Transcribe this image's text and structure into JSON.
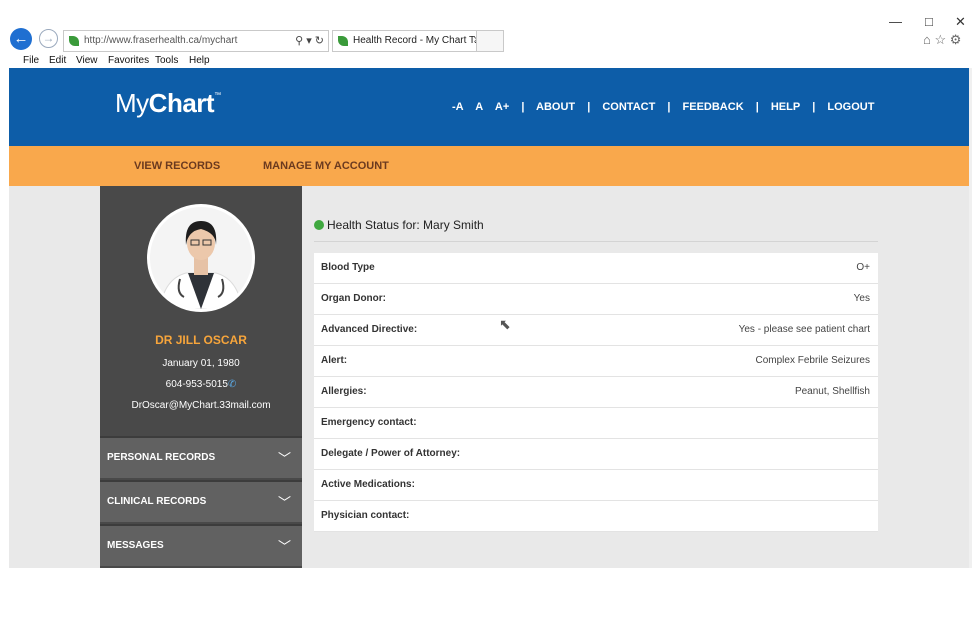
{
  "browser": {
    "url": "http://www.fraserhealth.ca/mychart",
    "tab_title": "Health Record - My Chart T...",
    "menu": [
      "File",
      "Edit",
      "View",
      "Favorites",
      "Tools",
      "Help"
    ],
    "window_controls": {
      "minimize": "—",
      "maximize": "□",
      "close": "✕"
    },
    "right_icons": "⌂ ☆ ⚙"
  },
  "header": {
    "logo_light": "My",
    "logo_bold": "Chart",
    "logo_tm": "™",
    "nav": [
      "-A",
      "A",
      "A+",
      "|",
      "ABOUT",
      "|",
      "CONTACT",
      "|",
      "FEEDBACK",
      "|",
      "HELP",
      "|",
      "LOGOUT"
    ]
  },
  "subnav": {
    "view_records": "VIEW RECORDS",
    "manage_account": "MANAGE MY ACCOUNT"
  },
  "profile": {
    "name": "DR JILL OSCAR",
    "dob": "January 01, 1980",
    "phone": "604-953-5015",
    "email": "DrOscar@MyChart.33mail.com"
  },
  "sidebar_sections": [
    "PERSONAL RECORDS",
    "CLINICAL RECORDS",
    "MESSAGES"
  ],
  "health_status": {
    "title": "Health Status for: Mary Smith",
    "rows": [
      {
        "key": "Blood Type",
        "value": "O+"
      },
      {
        "key": "Organ Donor:",
        "value": "Yes"
      },
      {
        "key": "Advanced Directive:",
        "value": "Yes - please see patient chart"
      },
      {
        "key": "Alert:",
        "value": "Complex Febrile Seizures"
      },
      {
        "key": "Allergies:",
        "value": "Peanut, Shellfish"
      },
      {
        "key": "Emergency contact:",
        "value": ""
      },
      {
        "key": "Delegate / Power of Attorney:",
        "value": ""
      },
      {
        "key": "Active Medications:",
        "value": ""
      },
      {
        "key": "Physician contact:",
        "value": ""
      }
    ]
  },
  "colors": {
    "header_blue": "#0d5da8",
    "subnav_orange": "#f9a84c",
    "sidebar_dark": "#494949",
    "name_orange": "#f7a53b"
  }
}
